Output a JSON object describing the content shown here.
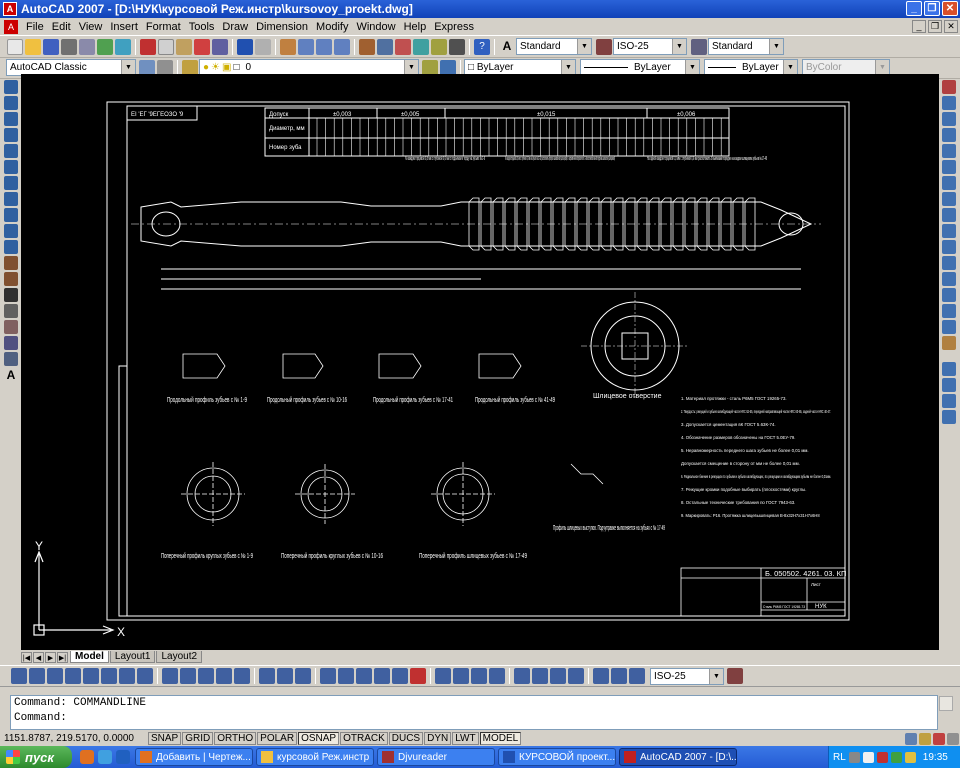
{
  "window": {
    "title": "AutoCAD 2007 - [D:\\НУК\\курсовой Реж.инстр\\kursovoy_proekt.dwg]"
  },
  "menu": [
    "File",
    "Edit",
    "View",
    "Insert",
    "Format",
    "Tools",
    "Draw",
    "Dimension",
    "Modify",
    "Window",
    "Help",
    "Express"
  ],
  "styles": {
    "text_style": "Standard",
    "dim_style": "ISO-25",
    "table_style": "Standard"
  },
  "workspace": "AutoCAD Classic",
  "layer": "0",
  "properties": {
    "color": "ByLayer",
    "linetype": "ByLayer",
    "lineweight": "ByLayer",
    "plotstyle": "ByColor"
  },
  "drawing": {
    "stamp_code": "ЕІ 'ЕГ '9ЕГЕОЗО '9",
    "table": {
      "row1": "Допуск",
      "row2": "Диаметр, мм",
      "row3": "Номер зуба",
      "tol1": "±0,003",
      "tol2": "±0,005",
      "tol3": "±0,015",
      "tol4": "±0,006"
    },
    "notes": [
      "% каждом торцевой 0,8 мм с глубиной 0,6 мм с подъемом к торцу на зубьях №1-9",
      "% каждом торцевой 0,8 мм с глубиной 0,6 мм на зубьях №10-16 расположить прорези шахматном (шлицевой) с направлением обработки по 1-ой вспомогательной прорези шахматом (шлицевой)",
      "На одной каждом торцевой 0,8 мм с глубиной 0,6 мм расположить 8 выемками порядке на каждом шлицевом зубьев №17-49"
    ],
    "profiles": [
      "Продольный профиль зубьев с № 1-9",
      "Продольный профиль зубьев с № 10-16",
      "Продольный профиль зубьев с № 17-41",
      "Продольный профиль зубьев с № 41-49"
    ],
    "hole_label": "Шлицевое отверстие",
    "cross_sections": [
      "Поперечный профиль круглых зубьев с № 1-9",
      "Поперечный профиль круглых зубьев с № 10-16",
      "Поперечный профиль шлицевых зубьев с № 17-49"
    ],
    "spline_note": "Профиль шлицевых выступов. Подчуправке выполняется на зубьях с № 17-49",
    "tech_req": [
      "1. Материал протяжки - сталь Р6М5 ГОСТ 19265-73.",
      "2. Твердость: режущей и зубьев калибрующей части HRC 62-65, передней направляющей части HRC 60-65, задней части HRC 40-47.",
      "3. Допускается цементация вК ГОСТ 5.63К-74.",
      "4. Обозначение размеров обозначены на ГОСТ 5.0ЕУ-79.",
      "5. Неравномерность переднего шага зубьев не более 0,01 мм.",
      "Допускается смещение в сторону от мм не более 0,01 мм.",
      "6. Радиальное биение в режущих по зубьям и зубьях калибрующих, по режущим и калибрующим зубьям не более 0,01мм.",
      "7. Режущие кромки подобные выбирать (плоскостями) круглы.",
      "8. Остальные технические требования по ГОСТ 7943-63.",
      "9. Маркировать: Р16. Протяжка шлицевышлицевая В-8х32Н7х31Н7х6Н8"
    ],
    "title_block": {
      "code": "Б. 050502. 4261. 03. КП",
      "org": "НУК",
      "sheet": "Лист",
      "material": "Сталь Р6М5 ГОСТ 19265-73"
    },
    "ucs": {
      "x": "X",
      "y": "Y"
    }
  },
  "layout_tabs": [
    "Model",
    "Layout1",
    "Layout2"
  ],
  "dim_style2": "ISO-25",
  "command": {
    "line1": "Command: COMMANDLINE",
    "line2": "Command:"
  },
  "status": {
    "coords": "1151.8787, 219.5170, 0.0000",
    "buttons": [
      "SNAP",
      "GRID",
      "ORTHO",
      "POLAR",
      "OSNAP",
      "OTRACK",
      "DUCS",
      "DYN",
      "LWT",
      "MODEL"
    ],
    "active": [
      "OSNAP",
      "MODEL"
    ]
  },
  "taskbar": {
    "start": "пуск",
    "tasks": [
      "Добавить | Чертеж...",
      "курсовой Реж.инстр",
      "Djvureader",
      "КУРСОВОЙ проект....",
      "AutoCAD 2007 - [D:\\..."
    ],
    "lang": "RL",
    "clock": "19:35"
  },
  "colors": {
    "title_blue": "#1042b8",
    "canvas": "#000000",
    "taskbar": "#245bd4",
    "start_green": "#2d8a2d"
  }
}
